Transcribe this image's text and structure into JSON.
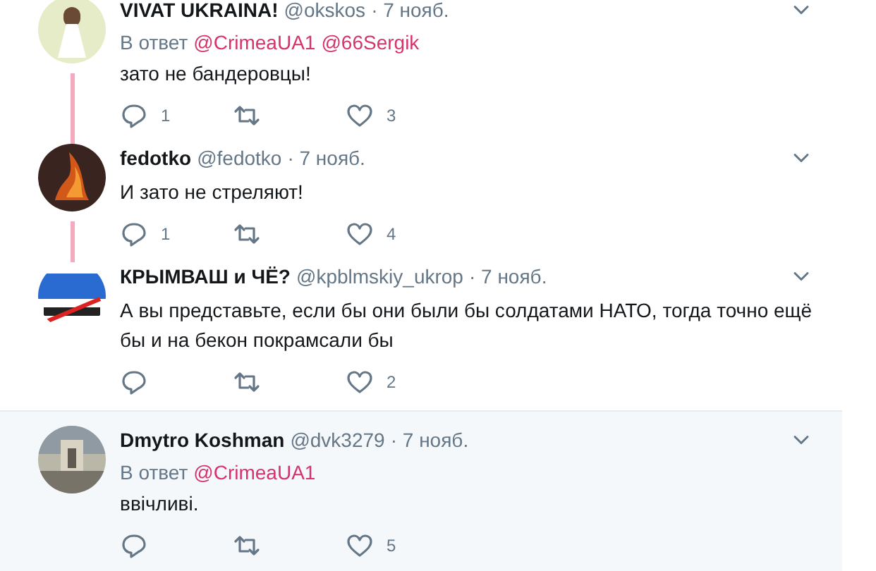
{
  "tweets": [
    {
      "name": "VIVAT UKRAINA!",
      "handle": "@okskos",
      "date": "· 7 нояб.",
      "reply_label": "В ответ",
      "reply_to": [
        "@CrimeaUA1",
        "@66Sergik"
      ],
      "text": "зато не бандеровцы!",
      "replies": "1",
      "likes": "3",
      "thread_line": true,
      "highlighted": false
    },
    {
      "name": "fedotko",
      "handle": "@fedotko",
      "date": "· 7 нояб.",
      "text": "И зато не стреляют!",
      "replies": "1",
      "likes": "4",
      "thread_line": true,
      "highlighted": false
    },
    {
      "name": "КРЫМВАШ и ЧЁ?",
      "handle": "@kpblmskiy_ukrop",
      "date": "· 7 нояб.",
      "text": "А вы представьте, если бы они были бы солдатами НАТО, тогда точно ещё бы и на бекон покрамсали бы",
      "likes": "2",
      "thread_line": false,
      "highlighted": false
    },
    {
      "name": "Dmytro Koshman",
      "handle": "@dvk3279",
      "date": "· 7 нояб.",
      "reply_label": "В ответ",
      "reply_to": [
        "@CrimeaUA1"
      ],
      "text": "ввічливі.",
      "likes": "5",
      "thread_line": false,
      "highlighted": true
    }
  ]
}
